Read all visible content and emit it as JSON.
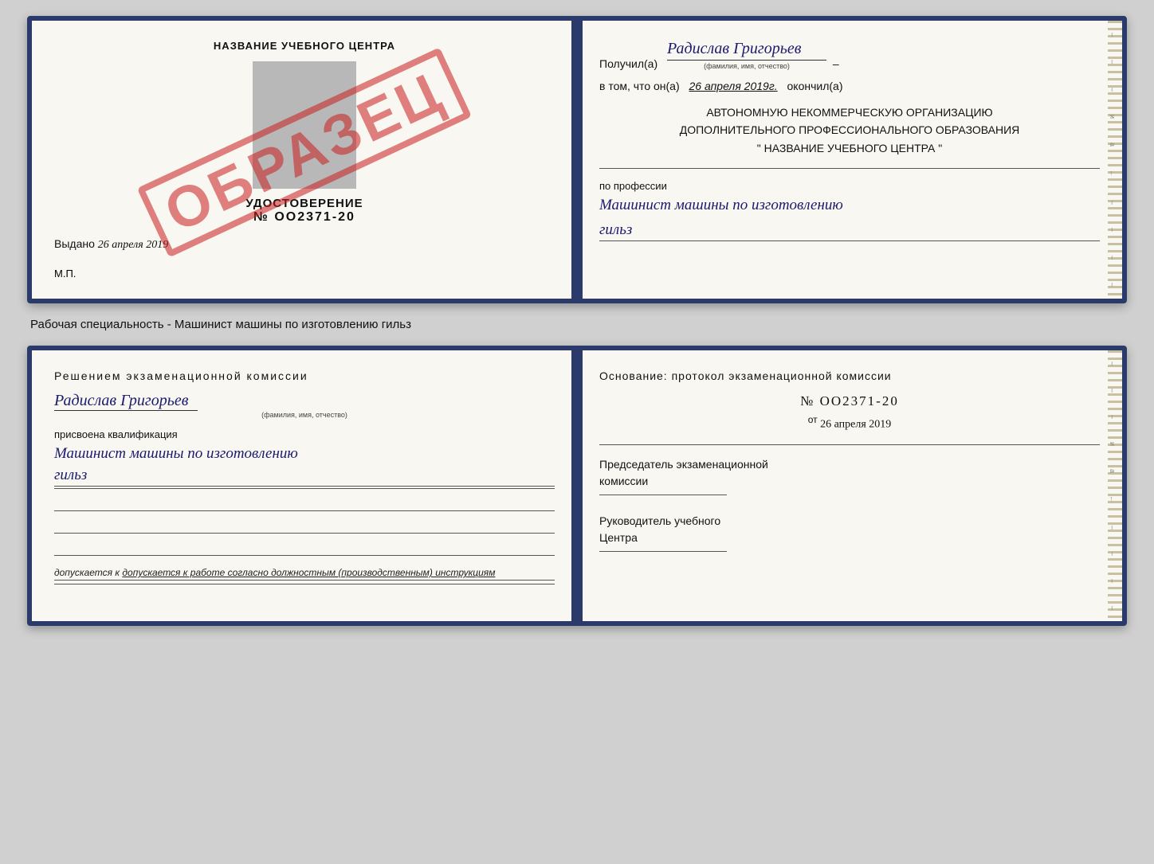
{
  "page": {
    "background": "#d0d0d0"
  },
  "top_book": {
    "left": {
      "title": "НАЗВАНИЕ УЧЕБНОГО ЦЕНТРА",
      "cert_label": "УДОСТОВЕРЕНИЕ",
      "cert_number": "№ OO2371-20",
      "issued_prefix": "Выдано",
      "issued_date": "26 апреля 2019",
      "mp_label": "М.П.",
      "stamp_text": "ОБРАЗЕЦ"
    },
    "right": {
      "received_prefix": "Получил(а)",
      "recipient_name": "Радислав Григорьев",
      "fio_hint": "(фамилия, имя, отчество)",
      "date_prefix": "в том, что он(а)",
      "date_value": "26 апреля 2019г.",
      "date_suffix": "окончил(а)",
      "org_line1": "АВТОНОМНУЮ НЕКОММЕРЧЕСКУЮ ОРГАНИЗАЦИЮ",
      "org_line2": "ДОПОЛНИТЕЛЬНОГО ПРОФЕССИОНАЛЬНОГО ОБРАЗОВАНИЯ",
      "org_line3": "\"  НАЗВАНИЕ УЧЕБНОГО ЦЕНТРА  \"",
      "profession_label": "по профессии",
      "profession_value": "Машинист машины по изготовлению",
      "profession_value2": "гильз"
    }
  },
  "between_label": "Рабочая специальность - Машинист машины по изготовлению гильз",
  "bottom_book": {
    "left": {
      "decision_header": "Решением  экзаменационной  комиссии",
      "name": "Радислав Григорьев",
      "fio_hint": "(фамилия, имя, отчество)",
      "qualification_label": "присвоена квалификация",
      "qualification_value": "Машинист  машины  по  изготовлению",
      "qualification_value2": "гильз",
      "admission_text": "допускается к  работе согласно должностным (производственным) инструкциям"
    },
    "right": {
      "foundation_label": "Основание:  протокол  экзаменационной  комиссии",
      "protocol_number": "№  OO2371-20",
      "from_prefix": "от",
      "protocol_date": "26 апреля 2019",
      "chairman_label1": "Председатель экзаменационной",
      "chairman_label2": "комиссии",
      "director_label1": "Руководитель учебного",
      "director_label2": "Центра"
    }
  }
}
